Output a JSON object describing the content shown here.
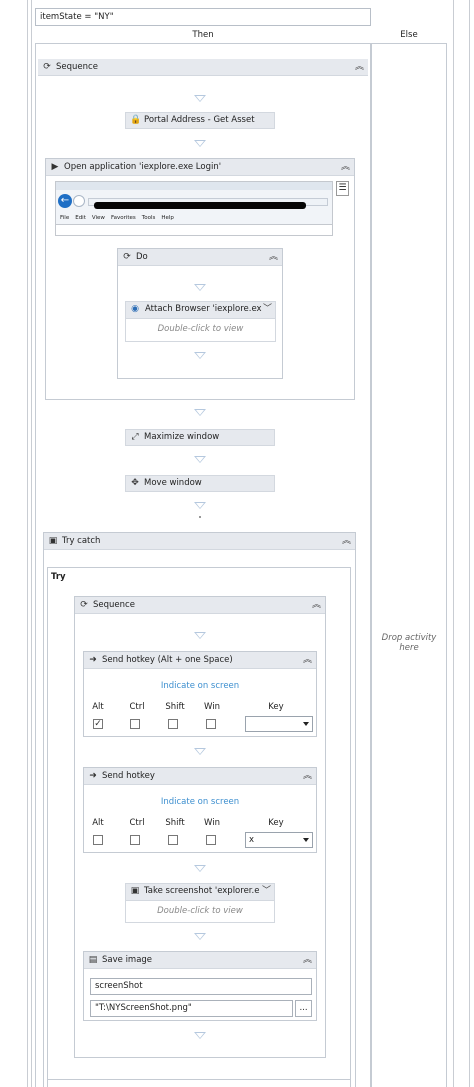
{
  "condition": "itemState = \"NY\"",
  "branches": {
    "then": "Then",
    "else": "Else"
  },
  "else_drop": "Drop activity here",
  "outer_sequence": {
    "title": "Sequence"
  },
  "portal": {
    "label": "Portal Address - Get Asset"
  },
  "open_app": {
    "title": "Open application 'iexplore.exe Login'",
    "menu": [
      "File",
      "Edit",
      "View",
      "Favorites",
      "Tools",
      "Help"
    ]
  },
  "do_scope": {
    "title": "Do"
  },
  "attach": {
    "label": "Attach Browser 'iexplore.ex",
    "hint": "Double-click to view"
  },
  "maximize": {
    "label": "Maximize window"
  },
  "move": {
    "label": "Move window"
  },
  "try_catch": {
    "title": "Try catch",
    "try_label": "Try"
  },
  "inner_sequence": {
    "title": "Sequence"
  },
  "hotkey1": {
    "title": "Send hotkey (Alt + one Space)",
    "indicate": "Indicate on screen",
    "mods": [
      "Alt",
      "Ctrl",
      "Shift",
      "Win"
    ],
    "key_label": "Key",
    "checked": [
      true,
      false,
      false,
      false
    ],
    "key_value": ""
  },
  "hotkey2": {
    "title": "Send hotkey",
    "indicate": "Indicate on screen",
    "mods": [
      "Alt",
      "Ctrl",
      "Shift",
      "Win"
    ],
    "key_label": "Key",
    "checked": [
      false,
      false,
      false,
      false
    ],
    "key_value": "x"
  },
  "screenshot": {
    "label": "Take screenshot 'explorer.e",
    "hint": "Double-click to view"
  },
  "save_image": {
    "title": "Save image",
    "image_var": "screenShot",
    "path": "\"T:\\NYScreenShot.png\"",
    "browse": "..."
  },
  "colors": {
    "header": "#e6e9ee",
    "link": "#3d8fcf",
    "arrow": "#b5c8de"
  }
}
